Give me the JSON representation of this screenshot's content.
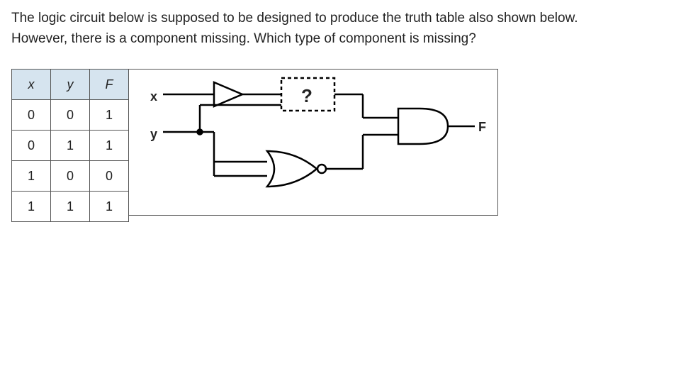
{
  "question_text": "The logic circuit below is supposed to be designed to produce the truth table also shown below. However, there is a component missing. Which type of component is missing?",
  "table": {
    "headers": [
      "x",
      "y",
      "F"
    ],
    "rows": [
      [
        "0",
        "0",
        "1"
      ],
      [
        "0",
        "1",
        "1"
      ],
      [
        "1",
        "0",
        "0"
      ],
      [
        "1",
        "1",
        "1"
      ]
    ]
  },
  "circuit": {
    "input_labels": {
      "x": "x",
      "y": "y"
    },
    "output_label": "F",
    "missing_label": "?"
  },
  "chart_data": {
    "type": "table",
    "description": "Logic circuit with two inputs x, y. x feeds a buffer/NOT-shaped triangle then into an unknown component '?'. y branches: one branch into '?', the other into an OR gate (together with y). Output of '?' and output of OR feed an AND gate whose output is F.",
    "truth_table": [
      {
        "x": 0,
        "y": 0,
        "F": 1
      },
      {
        "x": 0,
        "y": 1,
        "F": 1
      },
      {
        "x": 1,
        "y": 0,
        "F": 0
      },
      {
        "x": 1,
        "y": 1,
        "F": 1
      }
    ],
    "inputs": [
      "x",
      "y"
    ],
    "output": "F",
    "unknown_component": "?"
  }
}
